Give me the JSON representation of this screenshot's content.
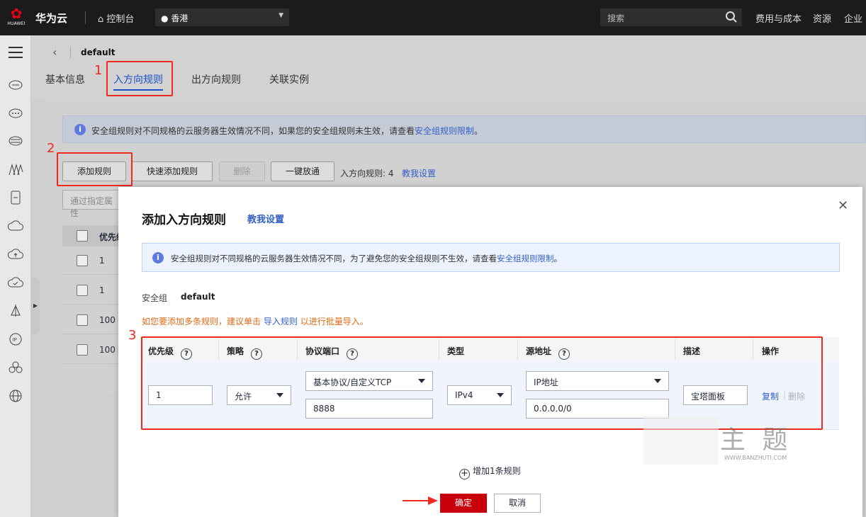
{
  "topbar": {
    "logo_text": "HUAWEI",
    "brand": "华为云",
    "console": "控制台",
    "region": "香港",
    "search_placeholder": "搜索",
    "nav": [
      "费用与成本",
      "资源",
      "企业"
    ]
  },
  "page": {
    "title": "default",
    "tabs": [
      "基本信息",
      "入方向规则",
      "出方向规则",
      "关联实例"
    ],
    "active_tab": "入方向规则"
  },
  "background": {
    "info_text": "安全组规则对不同规格的云服务器生效情况不同，如果您的安全组规则未生效，请查看",
    "info_link": "安全组规则限制",
    "info_end": "。",
    "buttons": [
      "添加规则",
      "快速添加规则",
      "删除",
      "一键放通"
    ],
    "rule_count": "入方向规则: 4",
    "help_link": "教我设置",
    "filter_placeholder": "通过指定属性",
    "col_priority": "优先级",
    "rows": [
      "1",
      "1",
      "100",
      "100"
    ]
  },
  "annotations": {
    "step1": "1",
    "step2": "2",
    "step3": "3"
  },
  "modal": {
    "title": "添加入方向规则",
    "help_link": "教我设置",
    "info_text": "安全组规则对不同规格的云服务器生效情况不同，为了避免您的安全组规则不生效，请查看",
    "info_link": "安全组规则限制",
    "info_end": "。",
    "sg_label": "安全组",
    "sg_value": "default",
    "import_hint_pre": "如您要添加多条规则，建议单击",
    "import_link": "导入规则",
    "import_hint_post": "以进行批量导入。",
    "columns": [
      "优先级",
      "策略",
      "协议端口",
      "类型",
      "源地址",
      "描述",
      "操作"
    ],
    "row": {
      "priority": "1",
      "policy": "允许",
      "protocol": "基本协议/自定义TCP",
      "port": "8888",
      "type": "IPv4",
      "source_type": "IP地址",
      "source_value": "0.0.0.0/0",
      "description": "宝塔面板",
      "copy": "复制",
      "delete": "删除"
    },
    "add_row": "增加1条规则",
    "ok": "确定",
    "cancel": "取消"
  },
  "watermark": {
    "main": "主 题",
    "url": "WWW.BANZHUTI.COM"
  },
  "colors": {
    "accent": "#1a50c8",
    "danger": "#c7000b",
    "annotation": "#ee2a1e",
    "hint": "#e06a14"
  }
}
